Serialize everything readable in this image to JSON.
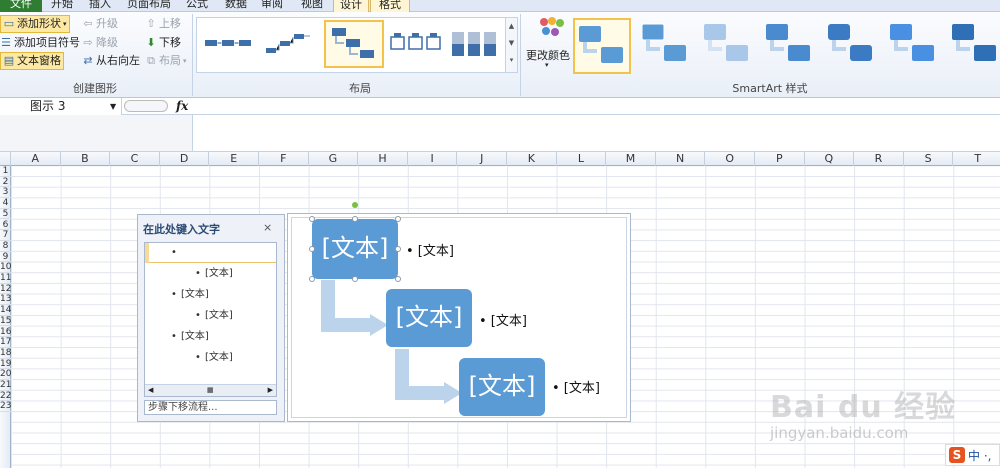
{
  "tabs": {
    "file": "文件",
    "home": "开始",
    "insert": "插入",
    "page_layout": "页面布局",
    "formulas": "公式",
    "data": "数据",
    "review": "审阅",
    "view": "视图",
    "design": "设计",
    "format": "格式"
  },
  "ribbon": {
    "create_graphic": {
      "label": "创建图形",
      "add_shape": "添加形状",
      "add_bullet": "添加项目符号",
      "text_pane": "文本窗格",
      "promote": "升级",
      "demote": "降级",
      "right_to_left": "从右向左",
      "move_up": "上移",
      "move_down": "下移",
      "layout": "布局"
    },
    "layouts": {
      "label": "布局"
    },
    "styles": {
      "change_colors": "更改颜色",
      "label": "SmartArt 样式"
    }
  },
  "formula_bar": {
    "name_box": "图示 3",
    "fx": "fx"
  },
  "columns": [
    "A",
    "B",
    "C",
    "D",
    "E",
    "F",
    "G",
    "H",
    "I",
    "J",
    "K",
    "L",
    "M",
    "N",
    "O",
    "P",
    "Q",
    "R",
    "S",
    "T"
  ],
  "rows": [
    "1",
    "2",
    "3",
    "4",
    "5",
    "6",
    "7",
    "8",
    "9",
    "10",
    "11",
    "12",
    "13",
    "14",
    "15",
    "16",
    "17",
    "18",
    "19",
    "20",
    "21",
    "22",
    "23"
  ],
  "text_pane": {
    "title": "在此处键入文字",
    "close": "⨯",
    "items": [
      {
        "level": 1,
        "text": ""
      },
      {
        "level": 2,
        "text": "[文本]"
      },
      {
        "level": 1,
        "text": "[文本]"
      },
      {
        "level": 2,
        "text": "[文本]"
      },
      {
        "level": 1,
        "text": "[文本]"
      },
      {
        "level": 2,
        "text": "[文本]"
      }
    ],
    "footer": "步骤下移流程..."
  },
  "smartart": {
    "boxes": [
      "[文本]",
      "[文本]",
      "[文本]"
    ],
    "bullets": [
      "• [文本]",
      "• [文本]",
      "• [文本]"
    ]
  },
  "watermark": {
    "brand": "Bai du 经验",
    "url": "jingyan.baidu.com"
  },
  "ime": {
    "icon": "S",
    "text": "中 ·,"
  },
  "colors": {
    "accent": "#5b9bd5",
    "arrow": "#bcd3ec",
    "file_tab": "#2f7d32"
  }
}
